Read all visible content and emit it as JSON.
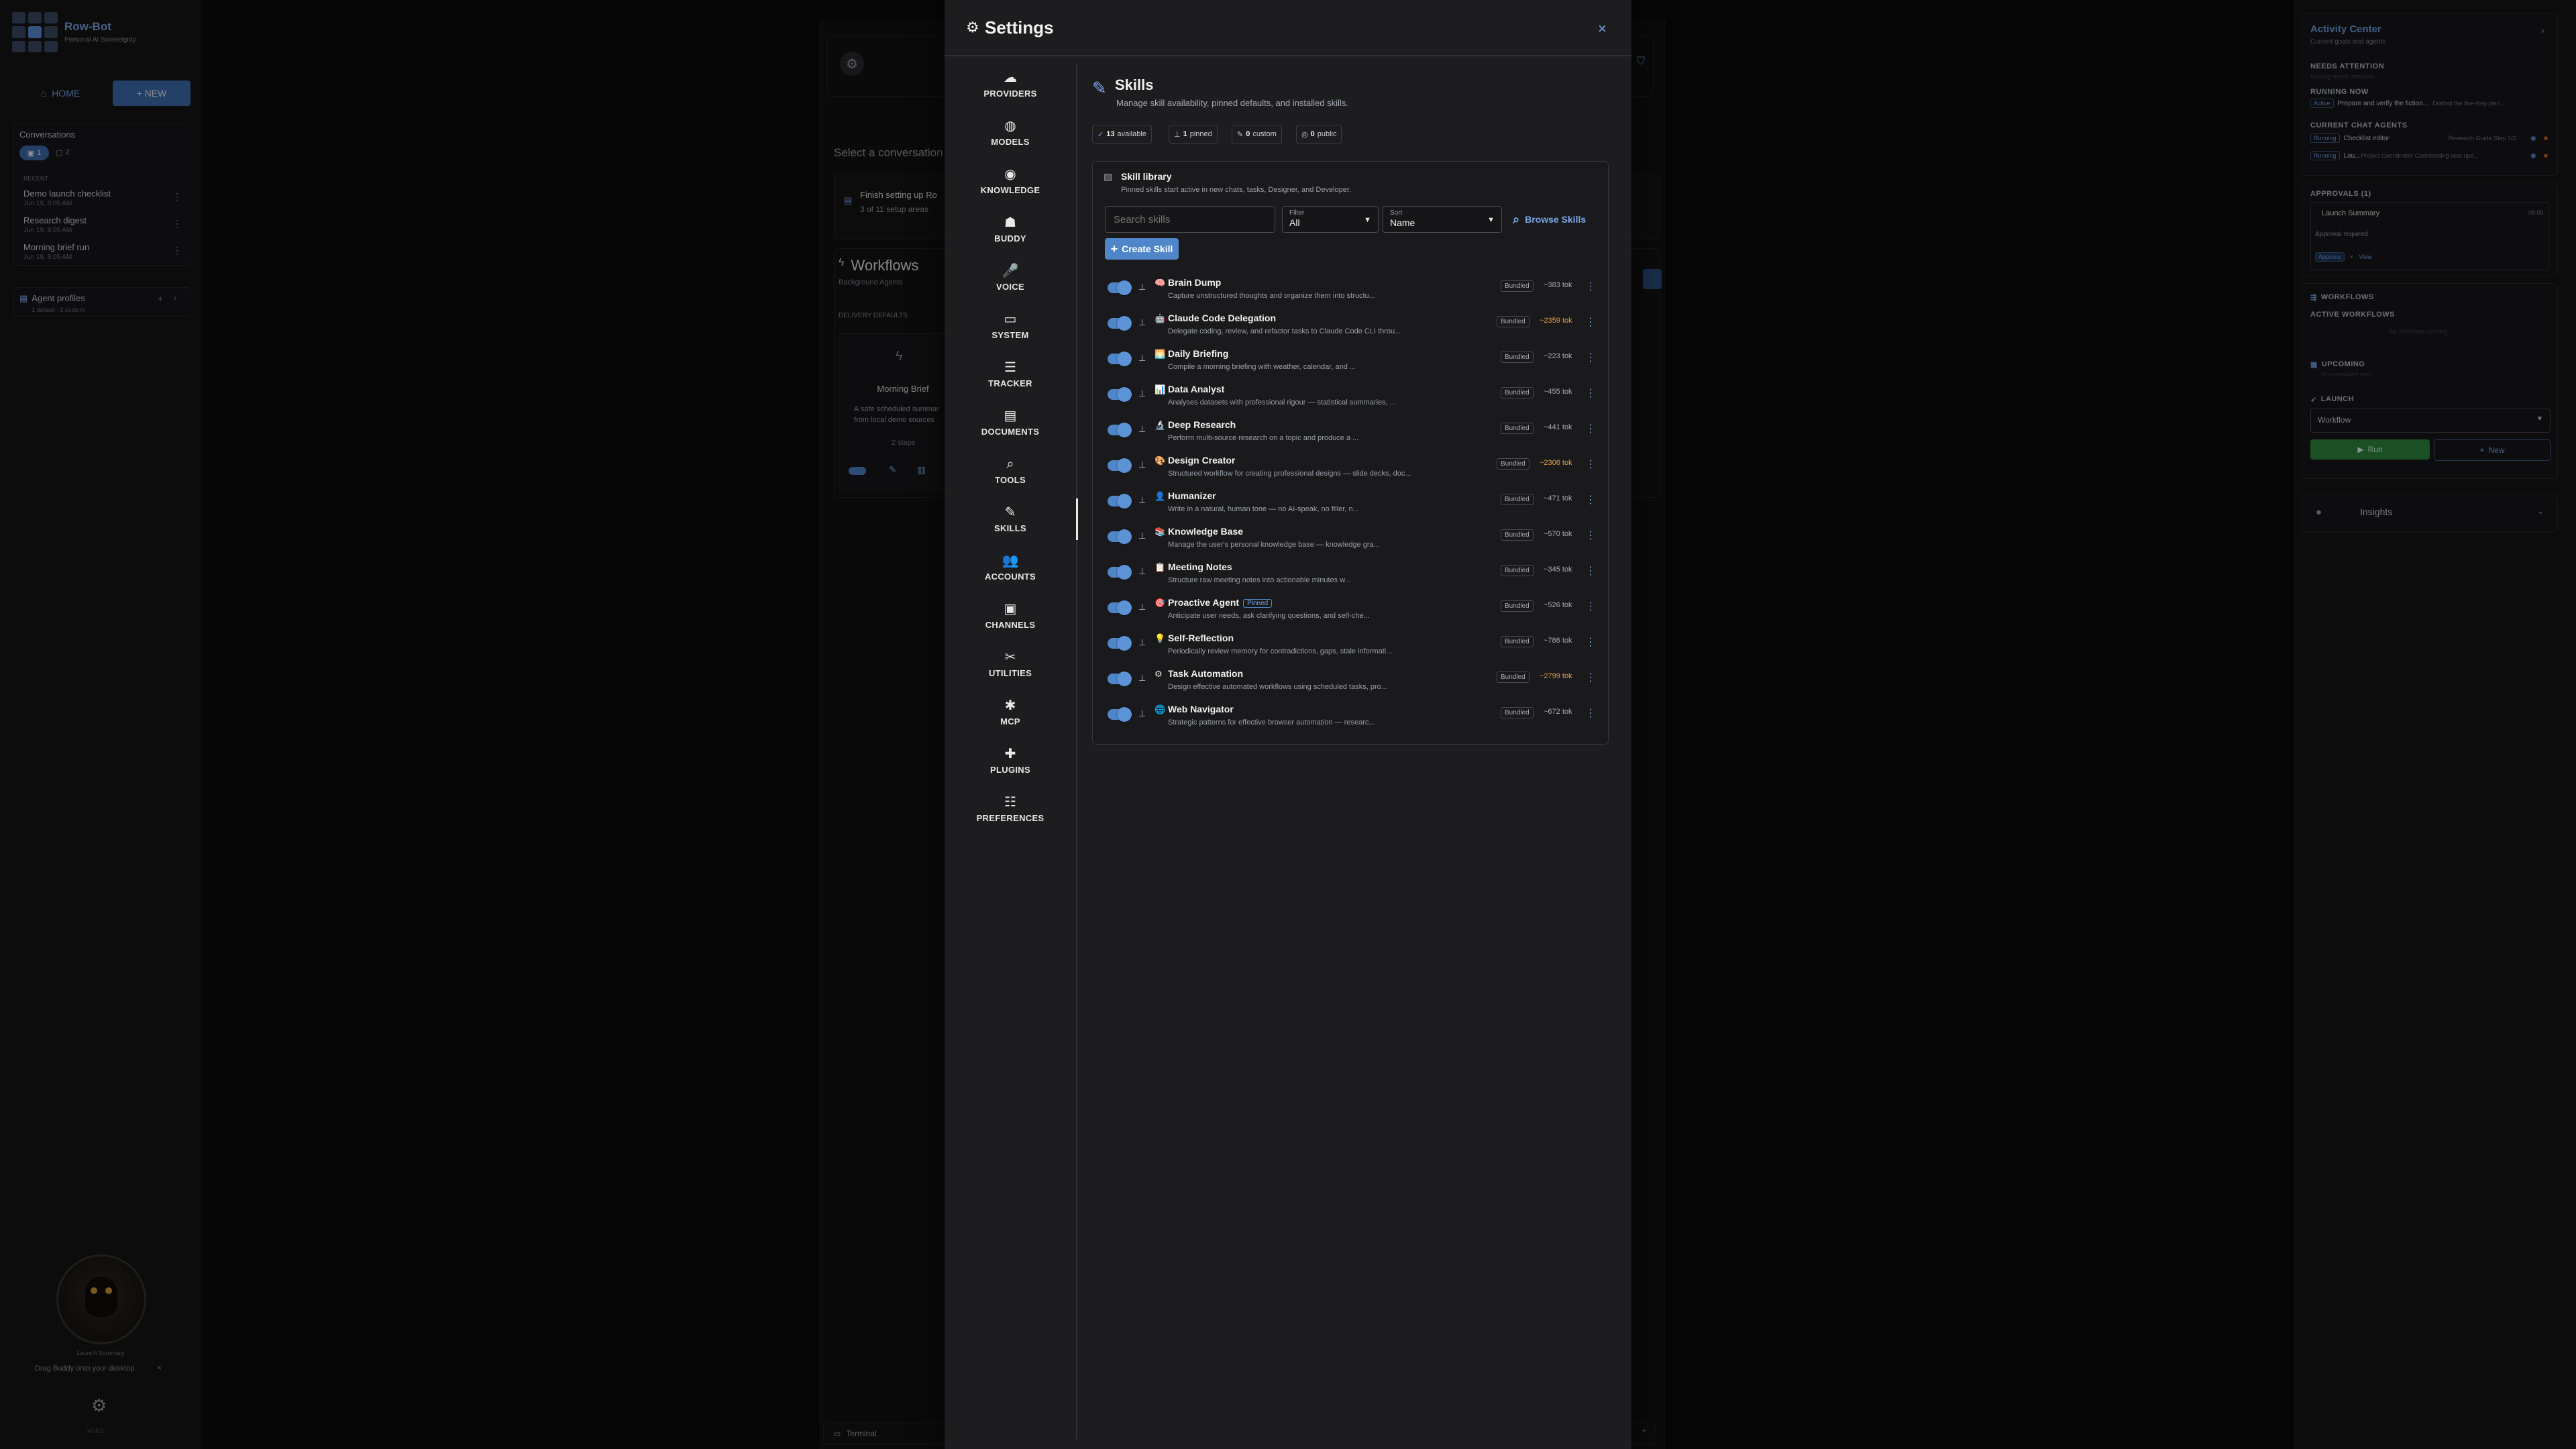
{
  "app": {
    "name": "Row-Bot",
    "tagline": "Personal AI Sovereignty"
  },
  "left": {
    "home": "HOME",
    "new": "+ NEW",
    "conversations_title": "Conversations",
    "count1": "1",
    "count2": "2",
    "recent_label": "RECENT",
    "items": [
      {
        "title": "Demo launch checklist",
        "time": "Jun 19, 8:05 AM"
      },
      {
        "title": "Research digest",
        "time": "Jun 19, 8:05 AM"
      },
      {
        "title": "Morning brief run",
        "time": "Jun 19, 8:05 AM"
      }
    ],
    "agent_profiles": "Agent profiles",
    "agent_sub": "1 default · 2 custom",
    "buddy_caption": "Launch Summary",
    "drag_hint": "Drag Buddy onto your desktop",
    "version": "v0.6.0"
  },
  "bg": {
    "select_conversation": "Select a conversation",
    "setup_title": "Finish setting up Ro",
    "setup_sub": "3 of 11 setup areas",
    "workflows": "Workflows",
    "background_agents": "Background Agents",
    "delivery_defaults": "DELIVERY DEFAULTS",
    "morning_brief": "Morning Brief",
    "morning_desc1": "A safe scheduled summar",
    "morning_desc2": "from local demo sources",
    "steps": "2 steps",
    "terminal": "Terminal"
  },
  "right": {
    "activity_center": "Activity Center",
    "activity_sub": "Current goals and agents",
    "needs_attention": "NEEDS ATTENTION",
    "needs_sub": "Nothing needs attention",
    "running_now": "RUNNING NOW",
    "running_chip": "Active",
    "running_text": "Prepare and verify the fiction...",
    "running_sub": "Drafted the five-step plan...",
    "current_chat_agents": "CURRENT CHAT AGENTS",
    "agent1_chip": "Running",
    "agent1_name": "Checklist editor",
    "agent1_role": "Research Guide  Step 1/2",
    "agent2_chip": "Running",
    "agent2_name": "Lau...",
    "agent2_role": "Project Coordinator  Coordinating next upd...",
    "approvals": "APPROVALS (1)",
    "approval_title": "Launch Summary",
    "approval_time": "08:05",
    "approval_req": "Approval required.",
    "approve": "Approve",
    "view": "View",
    "workflows": "WORKFLOWS",
    "active_workflows": "ACTIVE WORKFLOWS",
    "no_active": "No workflows running",
    "upcoming": "UPCOMING",
    "upcoming_sub": "No scheduled runs",
    "launch": "LAUNCH",
    "workflow_select": "Workflow",
    "run": "Run",
    "new": "New",
    "insights": "Insights"
  },
  "settings": {
    "title": "Settings",
    "close": "×",
    "nav": [
      {
        "label": "PROVIDERS",
        "icon": "☁"
      },
      {
        "label": "MODELS",
        "icon": "◍"
      },
      {
        "label": "KNOWLEDGE",
        "icon": "◉"
      },
      {
        "label": "BUDDY",
        "icon": "☗"
      },
      {
        "label": "VOICE",
        "icon": "🎤"
      },
      {
        "label": "SYSTEM",
        "icon": "▭"
      },
      {
        "label": "TRACKER",
        "icon": "☰"
      },
      {
        "label": "DOCUMENTS",
        "icon": "▤"
      },
      {
        "label": "TOOLS",
        "icon": "⌕"
      },
      {
        "label": "SKILLS",
        "icon": "✎"
      },
      {
        "label": "ACCOUNTS",
        "icon": "👥"
      },
      {
        "label": "CHANNELS",
        "icon": "▣"
      },
      {
        "label": "UTILITIES",
        "icon": "✂"
      },
      {
        "label": "MCP",
        "icon": "✱"
      },
      {
        "label": "PLUGINS",
        "icon": "✚"
      },
      {
        "label": "PREFERENCES",
        "icon": "☷"
      }
    ],
    "active": "SKILLS"
  },
  "skills": {
    "title": "Skills",
    "subtitle": "Manage skill availability, pinned defaults, and installed skills.",
    "stats": [
      {
        "num": "13",
        "label": "available"
      },
      {
        "num": "1",
        "label": "pinned"
      },
      {
        "num": "0",
        "label": "custom"
      },
      {
        "num": "0",
        "label": "public"
      }
    ],
    "library_title": "Skill library",
    "library_sub": "Pinned skills start active in new chats, tasks, Designer, and Developer.",
    "search_placeholder": "Search skills",
    "filter_label": "Filter",
    "filter_value": "All",
    "sort_label": "Sort",
    "sort_value": "Name",
    "browse": "Browse Skills",
    "create": "Create Skill",
    "bundled_label": "Bundled",
    "items": [
      {
        "name": "Brain Dump",
        "emoji": "🧠",
        "desc": "Capture unstructured thoughts and organize them into structu...",
        "tokens": "~383 tok",
        "high": false,
        "pinned": false
      },
      {
        "name": "Claude Code Delegation",
        "emoji": "🤖",
        "desc": "Delegate coding, review, and refactor tasks to Claude Code CLI throu...",
        "tokens": "~2359 tok",
        "high": true,
        "pinned": false
      },
      {
        "name": "Daily Briefing",
        "emoji": "🌅",
        "desc": "Compile a morning briefing with weather, calendar, and ...",
        "tokens": "~223 tok",
        "high": false,
        "pinned": false
      },
      {
        "name": "Data Analyst",
        "emoji": "📊",
        "desc": "Analyses datasets with professional rigour — statistical summaries, ...",
        "tokens": "~455 tok",
        "high": false,
        "pinned": false
      },
      {
        "name": "Deep Research",
        "emoji": "🔬",
        "desc": "Perform multi-source research on a topic and produce a ...",
        "tokens": "~441 tok",
        "high": false,
        "pinned": false
      },
      {
        "name": "Design Creator",
        "emoji": "🎨",
        "desc": "Structured workflow for creating professional designs — slide decks, doc...",
        "tokens": "~2306 tok",
        "high": true,
        "pinned": false
      },
      {
        "name": "Humanizer",
        "emoji": "👤",
        "desc": "Write in a natural, human tone — no AI-speak, no filler, n...",
        "tokens": "~471 tok",
        "high": false,
        "pinned": false
      },
      {
        "name": "Knowledge Base",
        "emoji": "📚",
        "desc": "Manage the user's personal knowledge base — knowledge gra...",
        "tokens": "~570 tok",
        "high": false,
        "pinned": false
      },
      {
        "name": "Meeting Notes",
        "emoji": "📋",
        "desc": "Structure raw meeting notes into actionable minutes w...",
        "tokens": "~345 tok",
        "high": false,
        "pinned": false
      },
      {
        "name": "Proactive Agent",
        "emoji": "🎯",
        "desc": "Anticipate user needs, ask clarifying questions, and self-che...",
        "tokens": "~526 tok",
        "high": false,
        "pinned": true,
        "pinned_label": "Pinned"
      },
      {
        "name": "Self-Reflection",
        "emoji": "💡",
        "desc": "Periodically review memory for contradictions, gaps, stale informati...",
        "tokens": "~786 tok",
        "high": false,
        "pinned": false
      },
      {
        "name": "Task Automation",
        "emoji": "⚙",
        "desc": "Design effective automated workflows using scheduled tasks, pro...",
        "tokens": "~2799 tok",
        "high": true,
        "pinned": false
      },
      {
        "name": "Web Navigator",
        "emoji": "🌐",
        "desc": "Strategic patterns for effective browser automation — researc...",
        "tokens": "~672 tok",
        "high": false,
        "pinned": false
      }
    ]
  },
  "colors": {
    "accent": "#4f86c9",
    "accent_text": "#7aa7e8",
    "warn": "#e0a14a",
    "run": "#2e8b3e"
  }
}
